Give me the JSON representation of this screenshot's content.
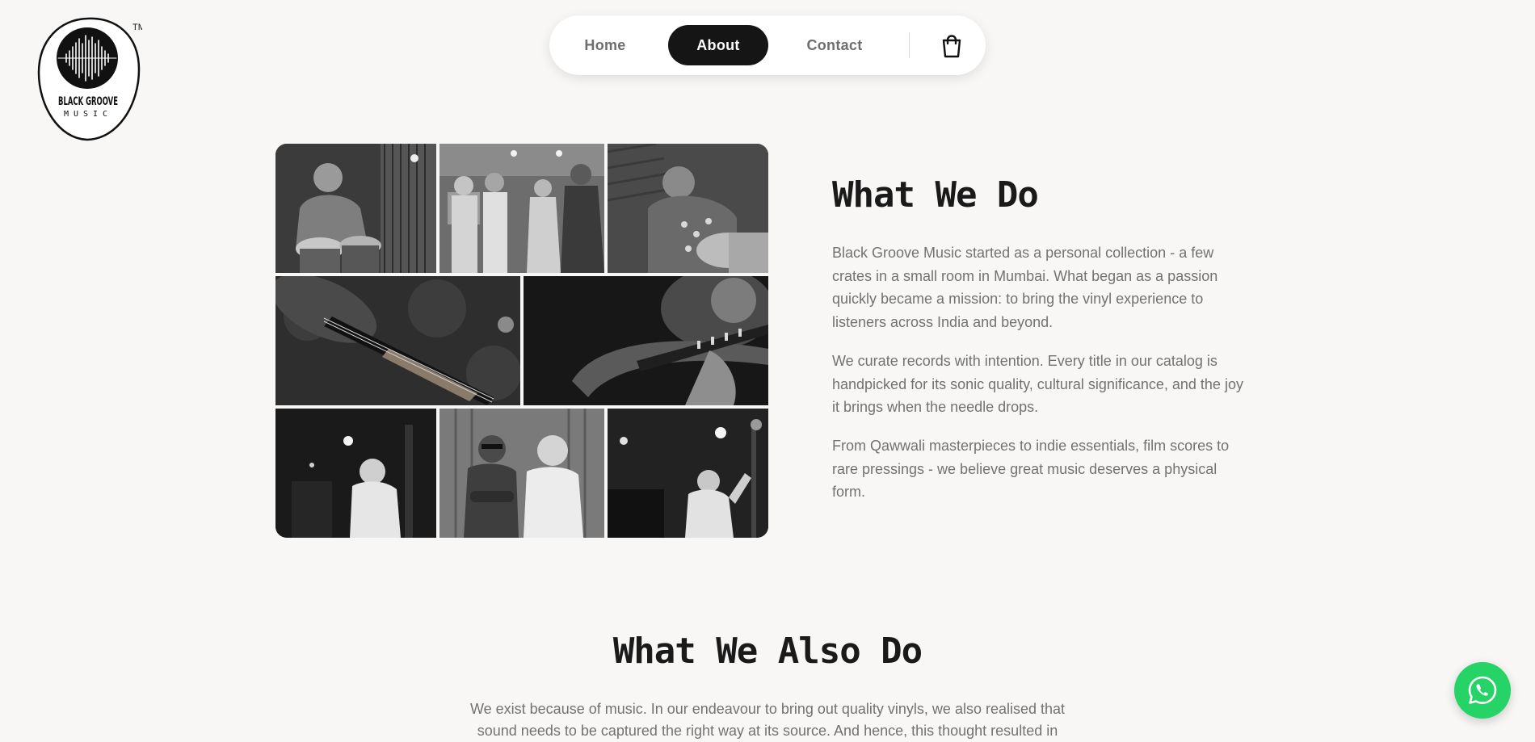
{
  "logo": {
    "line1": "BLACK GROOVE",
    "line2": "MUSIC",
    "trademark": "TM"
  },
  "nav": {
    "items": [
      {
        "label": "Home",
        "active": false
      },
      {
        "label": "About",
        "active": true
      },
      {
        "label": "Contact",
        "active": false
      }
    ],
    "cart_icon": "shopping-bag-icon"
  },
  "gallery": {
    "tiles": [
      {
        "subject": "tabla-player"
      },
      {
        "subject": "recording-group"
      },
      {
        "subject": "dholak-player"
      },
      {
        "subject": "sitar-closeup"
      },
      {
        "subject": "sitar-player"
      },
      {
        "subject": "singer-studio"
      },
      {
        "subject": "two-men"
      },
      {
        "subject": "singer-gesturing"
      }
    ]
  },
  "what_we_do": {
    "title": "What We Do",
    "paragraphs": [
      "Black Groove Music started as a personal collection - a few crates in a small room in Mumbai. What began as a passion quickly became a mission: to bring the vinyl experience to listeners across India and beyond.",
      "We curate records with intention. Every title in our catalog is handpicked for its sonic quality, cultural significance, and the joy it brings when the needle drops.",
      "From Qawwali masterpieces to indie essentials, film scores to rare pressings - we believe great music deserves a physical form."
    ]
  },
  "also_do": {
    "title": "What We Also Do",
    "paragraph": "We exist because of music. In our endeavour to bring out quality vinyls, we also realised that sound needs to be captured the right way at its source. And hence, this thought resulted in"
  },
  "whatsapp": {
    "icon": "whatsapp-icon"
  },
  "colors": {
    "accent_dark": "#151515",
    "whatsapp_green": "#25d366",
    "background": "#f8f7f5",
    "body_text": "#727272"
  }
}
